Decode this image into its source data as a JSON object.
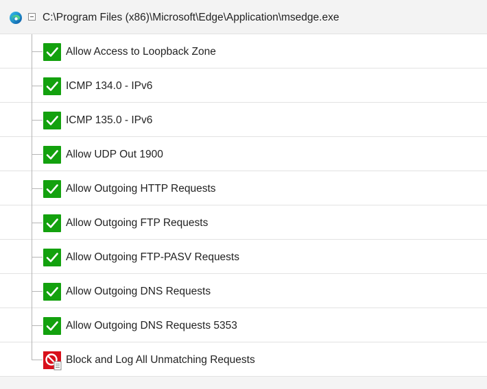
{
  "app": {
    "path": "C:\\Program Files (x86)\\Microsoft\\Edge\\Application\\msedge.exe",
    "app_icon": "edge-icon",
    "collapse_icon": "collapse-minus-icon"
  },
  "rules": [
    {
      "label": "Allow Access to Loopback Zone",
      "action": "allow",
      "icon": "check-icon"
    },
    {
      "label": "ICMP 134.0 - IPv6",
      "action": "allow",
      "icon": "check-icon"
    },
    {
      "label": "ICMP 135.0 - IPv6",
      "action": "allow",
      "icon": "check-icon"
    },
    {
      "label": "Allow UDP Out 1900",
      "action": "allow",
      "icon": "check-icon"
    },
    {
      "label": "Allow Outgoing HTTP Requests",
      "action": "allow",
      "icon": "check-icon"
    },
    {
      "label": "Allow Outgoing FTP Requests",
      "action": "allow",
      "icon": "check-icon"
    },
    {
      "label": "Allow Outgoing FTP-PASV Requests",
      "action": "allow",
      "icon": "check-icon"
    },
    {
      "label": "Allow Outgoing DNS Requests",
      "action": "allow",
      "icon": "check-icon"
    },
    {
      "label": "Allow Outgoing DNS Requests 5353",
      "action": "allow",
      "icon": "check-icon"
    },
    {
      "label": "Block and Log All Unmatching Requests",
      "action": "block",
      "icon": "block-log-icon"
    }
  ],
  "colors": {
    "allow": "#13a10e",
    "block": "#d8101b",
    "row_border": "#e2e2e2",
    "header_bg": "#f3f3f3"
  }
}
